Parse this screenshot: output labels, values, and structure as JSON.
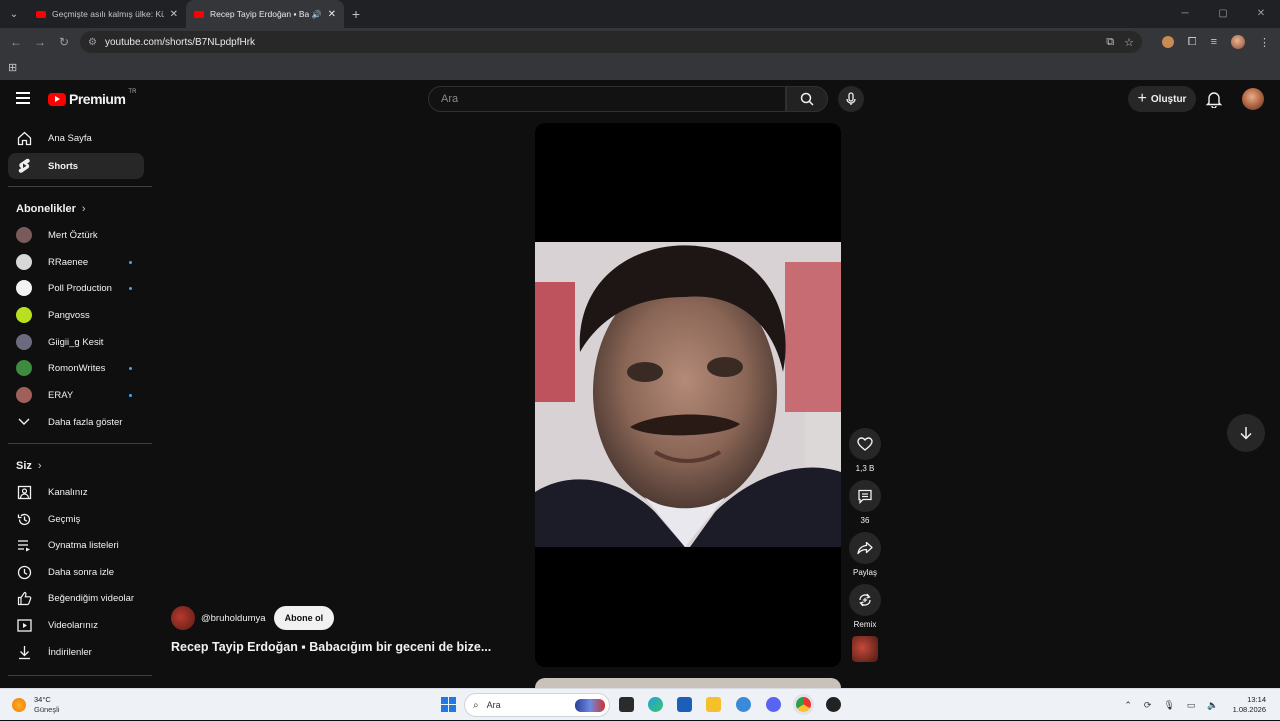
{
  "browser": {
    "tabs": [
      {
        "title": "Geçmişte asılı kalmış ülke: Küba",
        "active": false
      },
      {
        "title": "Recep Tayip Erdoğan ▪ Babacığı",
        "active": true
      }
    ],
    "url": "youtube.com/shorts/B7NLpdpfHrk"
  },
  "masthead": {
    "logo_text": "Premium",
    "country": "TR",
    "search_placeholder": "Ara",
    "create_label": "Oluştur"
  },
  "sidebar": {
    "main": [
      {
        "label": "Ana Sayfa",
        "icon": "home-icon"
      },
      {
        "label": "Shorts",
        "icon": "shorts-icon"
      }
    ],
    "subscriptions_title": "Abonelikler",
    "subscriptions": [
      {
        "label": "Mert Öztürk",
        "color": "#7a5a5a",
        "new": false
      },
      {
        "label": "RRaenee",
        "color": "#d8d8d8",
        "new": true
      },
      {
        "label": "Poll Production",
        "color": "#f2f2f2",
        "new": true
      },
      {
        "label": "Pangvoss",
        "color": "#b8e020",
        "new": false
      },
      {
        "label": "Giigii_g Kesit",
        "color": "#6b6b80",
        "new": false
      },
      {
        "label": "RomonWrites",
        "color": "#3e8a3e",
        "new": true
      },
      {
        "label": "ERAY",
        "color": "#a0605a",
        "new": true
      }
    ],
    "show_more": "Daha fazla göster",
    "you_title": "Siz",
    "you": [
      {
        "label": "Kanalınız",
        "icon": "channel-icon"
      },
      {
        "label": "Geçmiş",
        "icon": "history-icon"
      },
      {
        "label": "Oynatma listeleri",
        "icon": "playlists-icon"
      },
      {
        "label": "Daha sonra izle",
        "icon": "watch-later-icon"
      },
      {
        "label": "Beğendiğim videolar",
        "icon": "liked-icon"
      },
      {
        "label": "Videolarınız",
        "icon": "your-videos-icon"
      },
      {
        "label": "İndirilenler",
        "icon": "downloads-icon"
      }
    ]
  },
  "short": {
    "channel": "@bruholdumya",
    "subscribe_label": "Abone ol",
    "title": "Recep Tayip Erdoğan ▪ Babacığım bir geceni de bize...",
    "likes": "1,3 B",
    "comments": "36",
    "share_label": "Paylaş",
    "remix_label": "Remix"
  },
  "taskbar": {
    "temperature": "34°C",
    "weather": "Güneşli",
    "search_placeholder": "Ara",
    "time": "13:14",
    "date": "1.08.2026"
  }
}
